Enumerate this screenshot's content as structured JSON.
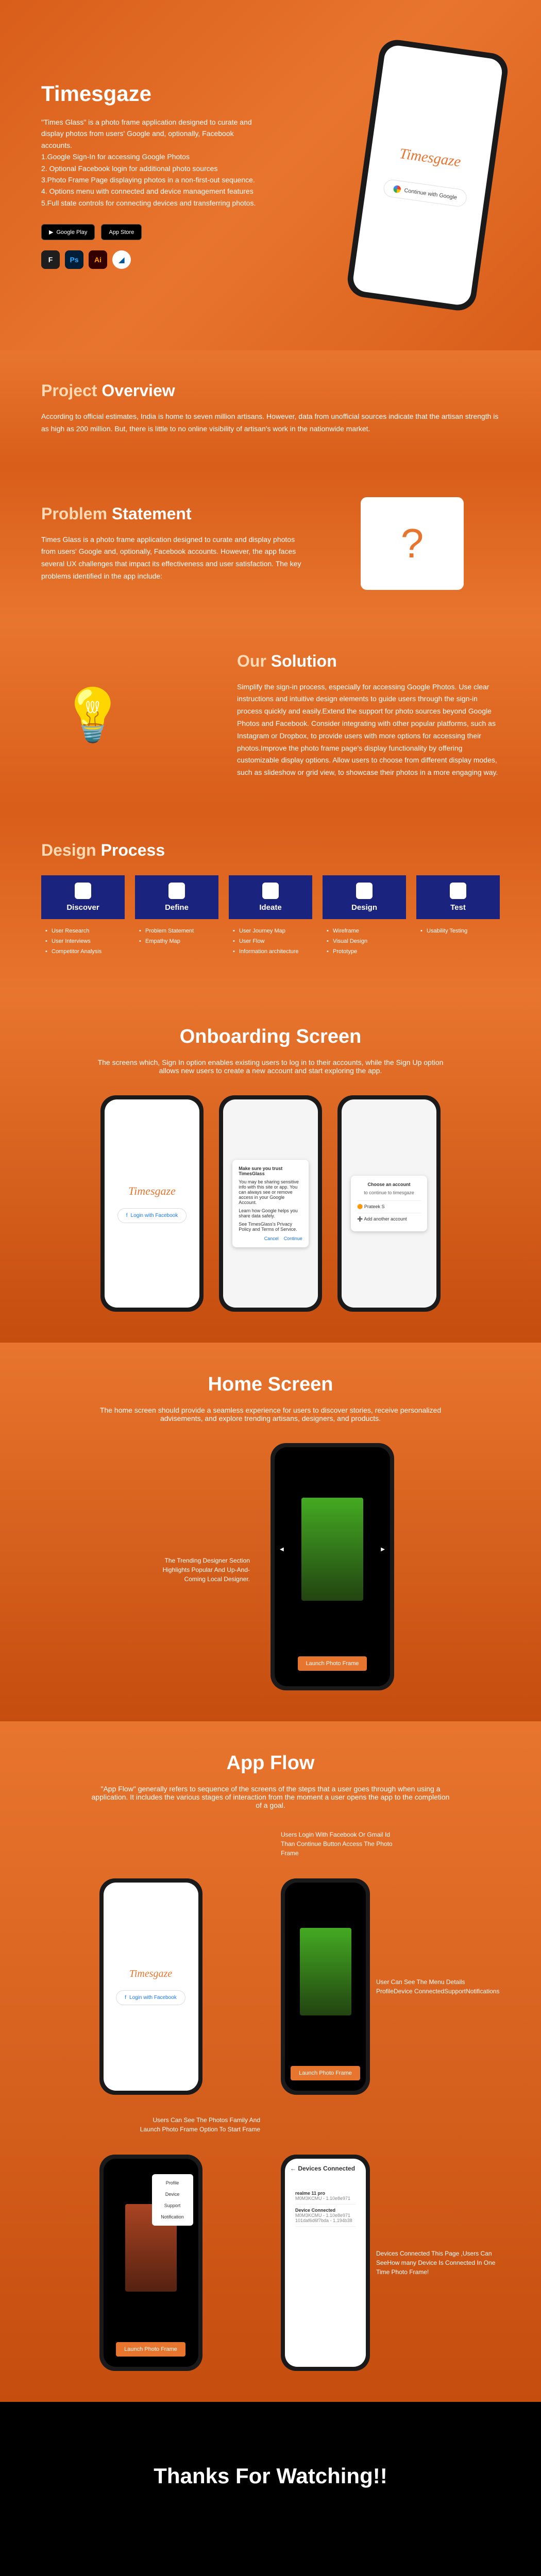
{
  "hero": {
    "title": "Timesgaze",
    "desc": "\"Times Glass\" is a photo frame application designed to curate and display photos from users' Google and, optionally, Facebook accounts.\n1.Google Sign-In for accessing Google Photos\n2. Optional Facebook login for additional photo sources\n3.Photo Frame Page displaying photos in a non-first-out sequence.\n4. Options menu with connected and device management features\n5.Full state controls for connecting devices and transferring photos.",
    "google_play": "Google Play",
    "app_store": "App Store",
    "logo": "Timesgaze",
    "continue_google": "Continue with Google"
  },
  "overview": {
    "heading_a": "Project",
    "heading_b": "Overview",
    "text": "According to official estimates, India is home to seven million artisans. However, data from unofficial sources indicate that the artisan strength is as high as 200 million. But, there is little to no online visibility of artisan's work in the nationwide market."
  },
  "problem": {
    "heading_a": "Problem",
    "heading_b": "Statement",
    "text": "Times Glass is a photo frame application designed to curate and display photos from users' Google and, optionally, Facebook accounts. However, the app faces several UX challenges that impact its effectiveness and user satisfaction. The key problems identified in the app include:"
  },
  "solution": {
    "heading_a": "Our",
    "heading_b": "Solution",
    "text": "Simplify the sign-in process, especially for accessing Google Photos. Use clear instructions and intuitive design elements to guide users through the sign-in process quickly and easily.Extend the support for photo sources beyond Google Photos and Facebook. Consider integrating with other popular platforms, such as Instagram or Dropbox, to provide users with more options for accessing their photos.Improve the photo frame page's display functionality by offering customizable display options. Allow users to choose from different display modes, such as slideshow or grid view, to showcase their photos in a more engaging way."
  },
  "design": {
    "heading_a": "Design",
    "heading_b": "Process",
    "steps": [
      {
        "title": "Discover",
        "items": [
          "User Research",
          "User Interviews",
          "Competitor Analysis"
        ]
      },
      {
        "title": "Define",
        "items": [
          "Problem Statement",
          "Empathy Map"
        ]
      },
      {
        "title": "Ideate",
        "items": [
          "User Journey Map",
          "User Flow",
          "Information architecture"
        ]
      },
      {
        "title": "Design",
        "items": [
          "Wireframe",
          "Visual Design",
          "Prototype"
        ]
      },
      {
        "title": "Test",
        "items": [
          "Usability Testing"
        ]
      }
    ]
  },
  "onboard": {
    "heading": "Onboarding Screen",
    "text": "The screens which, Sign In option enables existing users to log in to their accounts, while the Sign Up option allows new users to create a new account and start exploring the app.",
    "login_fb": "Login with Facebook",
    "dialog_title": "Make sure you trust TimesGlass",
    "dialog_body": "You may be sharing sensitive info with this site or app. You can always see or remove access in your Google Account.",
    "dialog_learn": "Learn how Google helps you share data safely.",
    "dialog_privacy": "See TimesGlass's Privacy Policy and Terms of Service.",
    "dialog_cancel": "Cancel",
    "dialog_continue": "Continue",
    "choose_title": "Choose an account",
    "choose_sub": "to continue to timesgaze",
    "choose_name": "Prateek S",
    "choose_add": "Add another account"
  },
  "home": {
    "heading": "Home Screen",
    "text": "The home screen should provide a seamless experience for users to discover stories, receive personalized advisements, and explore trending artisans, designers, and products.",
    "caption": "The Trending Designer Section Highlights Popular And Up-And-Coming Local Designer.",
    "launch": "Launch Photo Frame"
  },
  "flow": {
    "heading": "App Flow",
    "text": "\"App Flow\" generally refers to sequence of the screens of the steps that a user goes through when using a application. It includes the various stages of interaction from the moment a user opens the app to the completion of a goal.",
    "caption1": "Users Login With Facebook Or Gmail Id Than Continue Button Access The Photo Frame",
    "caption2": "User Can See The Menu Details ProfileDevice ConnectedSupportNotifications",
    "caption3": "Users Can See The Photos Family And Launch Photo Frame Option To Start Frame",
    "caption4": "Devices Connected This Page ,Users Can SeeHow many Device Is Connected In One Time Photo Frame!",
    "menu_items": [
      "Profile",
      "Device",
      "Support",
      "Notification"
    ],
    "devices_title": "Devices Connected",
    "devices": [
      {
        "name": "realme 11 pro",
        "serial": "M0M3KCMU - 1.10e8e971"
      },
      {
        "name": "Device Connected",
        "serial": "M0M3KCMU - 1.10e8e971",
        "code": "101daf6d6f7bda - 1.194b38"
      }
    ]
  },
  "footer": {
    "text": "Thanks For Watching!!"
  }
}
